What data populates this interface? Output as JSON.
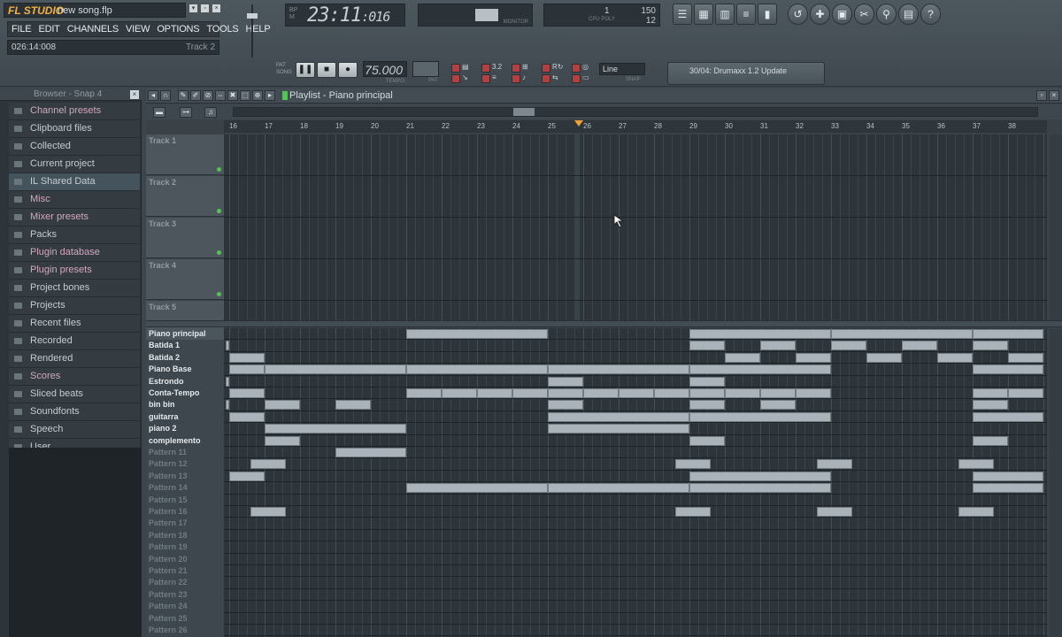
{
  "app": {
    "logo": "FL STUDIO",
    "song_name": "new song.flp",
    "menu": [
      "FILE",
      "EDIT",
      "CHANNELS",
      "VIEW",
      "OPTIONS",
      "TOOLS",
      "HELP"
    ],
    "hint_time": "026:14:008",
    "hint_track": "Track 2",
    "lcd_small": [
      "BP",
      "M"
    ],
    "lcd_time_main": "23:11",
    "lcd_time_sub": ":016",
    "scope_label": "MONITOR",
    "cpu_value": "150",
    "cpu_one": "1",
    "cpu_poly": "12",
    "cpu_label": "CPU POLY",
    "pat_song": [
      "PAT",
      "SONG"
    ],
    "tempo": "75.000",
    "tempo_label": "TEMPO",
    "pat_label": "PAT",
    "snap_value": "Line",
    "snap_label": "SNAP",
    "hint_panel": "30/04: Drumaxx 1.2 Update",
    "rec_numbers": "3.2"
  },
  "browser": {
    "title": "Browser - Snap 4",
    "items": [
      {
        "label": "Channel presets",
        "color": "pink"
      },
      {
        "label": "Clipboard files",
        "color": "white"
      },
      {
        "label": "Collected",
        "color": "white"
      },
      {
        "label": "Current project",
        "color": "white"
      },
      {
        "label": "IL Shared Data",
        "color": "white",
        "highlight": true
      },
      {
        "label": "Misc",
        "color": "pink"
      },
      {
        "label": "Mixer presets",
        "color": "pink"
      },
      {
        "label": "Packs",
        "color": "white"
      },
      {
        "label": "Plugin database",
        "color": "pink"
      },
      {
        "label": "Plugin presets",
        "color": "pink"
      },
      {
        "label": "Project bones",
        "color": "white"
      },
      {
        "label": "Projects",
        "color": "white"
      },
      {
        "label": "Recent files",
        "color": "white"
      },
      {
        "label": "Recorded",
        "color": "white"
      },
      {
        "label": "Rendered",
        "color": "white"
      },
      {
        "label": "Scores",
        "color": "pink"
      },
      {
        "label": "Sliced beats",
        "color": "white"
      },
      {
        "label": "Soundfonts",
        "color": "white"
      },
      {
        "label": "Speech",
        "color": "white"
      },
      {
        "label": "User",
        "color": "white"
      }
    ]
  },
  "playlist": {
    "title": "Playlist - Piano principal",
    "ruler_ticks": [
      "16",
      "17",
      "18",
      "19",
      "20",
      "21",
      "22",
      "23",
      "24",
      "25",
      "26",
      "27",
      "28",
      "29",
      "30",
      "31",
      "32",
      "33",
      "34",
      "35",
      "36",
      "37",
      "38"
    ],
    "tracks": [
      "Track 1",
      "Track 2",
      "Track 3",
      "Track 4",
      "Track 5"
    ],
    "patterns": [
      {
        "name": "Piano principal",
        "active": true
      },
      {
        "name": "Batida 1",
        "active": true
      },
      {
        "name": "Batida 2",
        "active": true
      },
      {
        "name": "Piano Base",
        "active": true
      },
      {
        "name": "Estrondo",
        "active": true
      },
      {
        "name": "Conta-Tempo",
        "active": true
      },
      {
        "name": "bin bin",
        "active": true
      },
      {
        "name": "guitarra",
        "active": true
      },
      {
        "name": "piano 2",
        "active": true
      },
      {
        "name": "complemento",
        "active": true
      },
      {
        "name": "Pattern 11",
        "active": false
      },
      {
        "name": "Pattern 12",
        "active": false
      },
      {
        "name": "Pattern 13",
        "active": false
      },
      {
        "name": "Pattern 14",
        "active": false
      },
      {
        "name": "Pattern 15",
        "active": false
      },
      {
        "name": "Pattern 16",
        "active": false
      },
      {
        "name": "Pattern 17",
        "active": false
      },
      {
        "name": "Pattern 18",
        "active": false
      },
      {
        "name": "Pattern 19",
        "active": false
      },
      {
        "name": "Pattern 20",
        "active": false
      },
      {
        "name": "Pattern 21",
        "active": false
      },
      {
        "name": "Pattern 22",
        "active": false
      },
      {
        "name": "Pattern 23",
        "active": false
      },
      {
        "name": "Pattern 24",
        "active": false
      },
      {
        "name": "Pattern 25",
        "active": false
      },
      {
        "name": "Pattern 26",
        "active": false
      }
    ],
    "clips": [
      {
        "row": 0,
        "start": 21,
        "end": 25
      },
      {
        "row": 0,
        "start": 29,
        "end": 33
      },
      {
        "row": 0,
        "start": 33,
        "end": 37
      },
      {
        "row": 0,
        "start": 37,
        "end": 39
      },
      {
        "row": 1,
        "start": 15.9,
        "end": 16
      },
      {
        "row": 1,
        "start": 29,
        "end": 30
      },
      {
        "row": 1,
        "start": 31,
        "end": 32
      },
      {
        "row": 1,
        "start": 33,
        "end": 34
      },
      {
        "row": 1,
        "start": 35,
        "end": 36
      },
      {
        "row": 1,
        "start": 37,
        "end": 38
      },
      {
        "row": 2,
        "start": 16,
        "end": 17
      },
      {
        "row": 2,
        "start": 30,
        "end": 31
      },
      {
        "row": 2,
        "start": 32,
        "end": 33
      },
      {
        "row": 2,
        "start": 34,
        "end": 35
      },
      {
        "row": 2,
        "start": 36,
        "end": 37
      },
      {
        "row": 2,
        "start": 38,
        "end": 39
      },
      {
        "row": 3,
        "start": 16,
        "end": 17
      },
      {
        "row": 3,
        "start": 17,
        "end": 21
      },
      {
        "row": 3,
        "start": 21,
        "end": 25
      },
      {
        "row": 3,
        "start": 25,
        "end": 29
      },
      {
        "row": 3,
        "start": 29,
        "end": 33
      },
      {
        "row": 3,
        "start": 37,
        "end": 39
      },
      {
        "row": 4,
        "start": 15.9,
        "end": 16
      },
      {
        "row": 4,
        "start": 25,
        "end": 26
      },
      {
        "row": 4,
        "start": 29,
        "end": 30
      },
      {
        "row": 5,
        "start": 16,
        "end": 17
      },
      {
        "row": 5,
        "start": 21,
        "end": 22
      },
      {
        "row": 5,
        "start": 22,
        "end": 23
      },
      {
        "row": 5,
        "start": 23,
        "end": 24
      },
      {
        "row": 5,
        "start": 24,
        "end": 25
      },
      {
        "row": 5,
        "start": 25,
        "end": 26
      },
      {
        "row": 5,
        "start": 26,
        "end": 27
      },
      {
        "row": 5,
        "start": 27,
        "end": 28
      },
      {
        "row": 5,
        "start": 28,
        "end": 29
      },
      {
        "row": 5,
        "start": 29,
        "end": 30
      },
      {
        "row": 5,
        "start": 30,
        "end": 31
      },
      {
        "row": 5,
        "start": 31,
        "end": 32
      },
      {
        "row": 5,
        "start": 32,
        "end": 33
      },
      {
        "row": 5,
        "start": 37,
        "end": 38
      },
      {
        "row": 5,
        "start": 38,
        "end": 39
      },
      {
        "row": 6,
        "start": 15.9,
        "end": 16
      },
      {
        "row": 6,
        "start": 17,
        "end": 18
      },
      {
        "row": 6,
        "start": 19,
        "end": 20
      },
      {
        "row": 6,
        "start": 25,
        "end": 26
      },
      {
        "row": 6,
        "start": 29,
        "end": 30
      },
      {
        "row": 6,
        "start": 31,
        "end": 32
      },
      {
        "row": 6,
        "start": 37,
        "end": 38
      },
      {
        "row": 7,
        "start": 16,
        "end": 17
      },
      {
        "row": 7,
        "start": 25,
        "end": 29
      },
      {
        "row": 7,
        "start": 29,
        "end": 33
      },
      {
        "row": 7,
        "start": 37,
        "end": 39
      },
      {
        "row": 8,
        "start": 17,
        "end": 21
      },
      {
        "row": 8,
        "start": 25,
        "end": 29
      },
      {
        "row": 9,
        "start": 17,
        "end": 18
      },
      {
        "row": 9,
        "start": 29,
        "end": 30
      },
      {
        "row": 9,
        "start": 37,
        "end": 38
      },
      {
        "row": 10,
        "start": 19,
        "end": 21
      },
      {
        "row": 11,
        "start": 16.6,
        "end": 17.6
      },
      {
        "row": 11,
        "start": 28.6,
        "end": 29.6
      },
      {
        "row": 11,
        "start": 32.6,
        "end": 33.6
      },
      {
        "row": 11,
        "start": 36.6,
        "end": 37.6
      },
      {
        "row": 12,
        "start": 16,
        "end": 17
      },
      {
        "row": 12,
        "start": 29,
        "end": 33
      },
      {
        "row": 12,
        "start": 37,
        "end": 39
      },
      {
        "row": 13,
        "start": 21,
        "end": 25
      },
      {
        "row": 13,
        "start": 25,
        "end": 29
      },
      {
        "row": 13,
        "start": 29,
        "end": 33
      },
      {
        "row": 13,
        "start": 37,
        "end": 39
      },
      {
        "row": 15,
        "start": 16.6,
        "end": 17.6
      },
      {
        "row": 15,
        "start": 28.6,
        "end": 29.6
      },
      {
        "row": 15,
        "start": 32.6,
        "end": 33.6
      },
      {
        "row": 15,
        "start": 36.6,
        "end": 37.6
      }
    ]
  },
  "colors": {
    "accent_green": "#4fc650",
    "clip": "#aab3b9",
    "pink_text": "#d0a8c0",
    "marker": "#f0a030"
  }
}
